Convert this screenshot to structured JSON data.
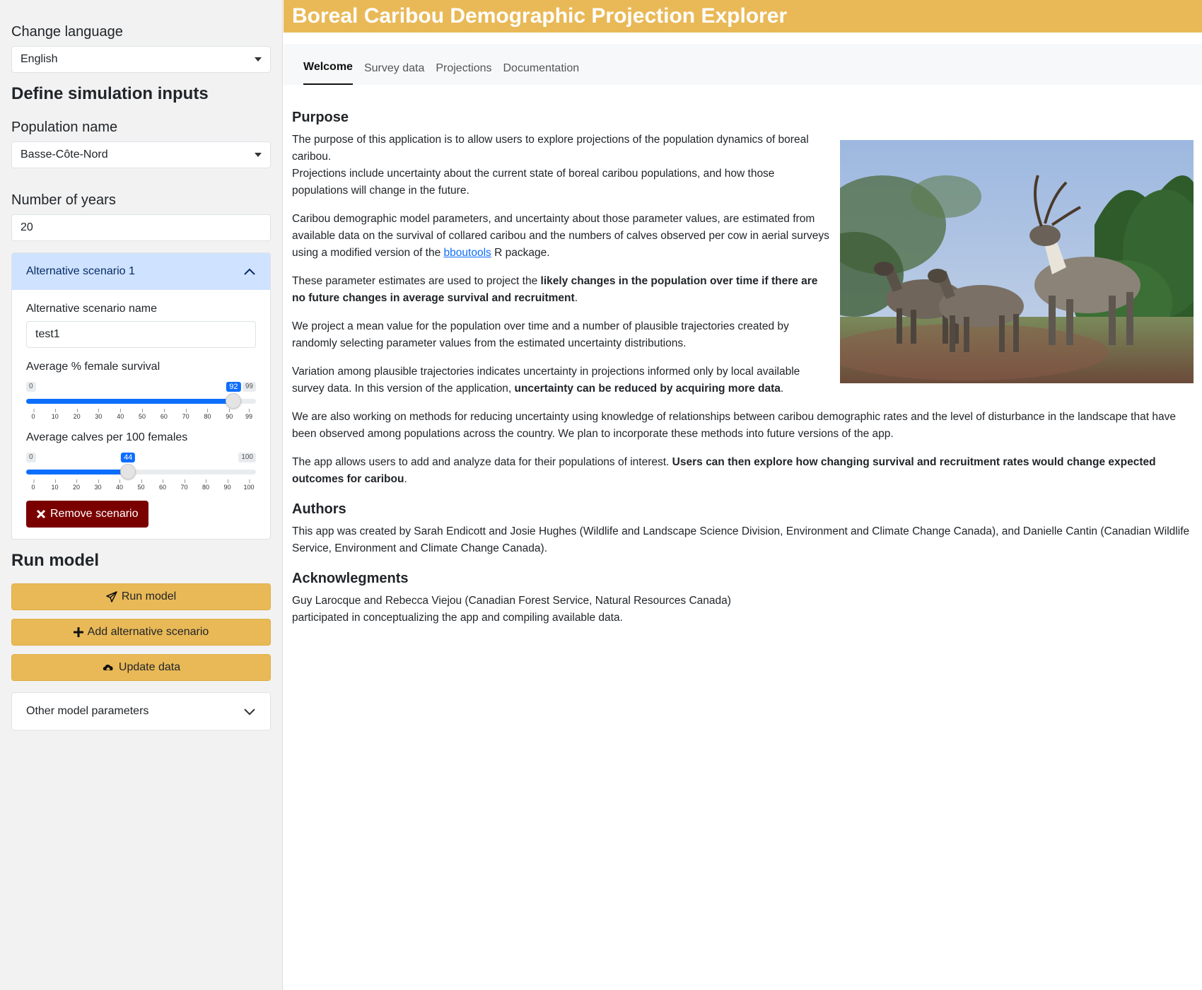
{
  "sidebar": {
    "language_label": "Change language",
    "language_value": "English",
    "inputs_heading": "Define simulation inputs",
    "population_label": "Population name",
    "population_value": "Basse-Côte-Nord",
    "years_label": "Number of years",
    "years_value": "20",
    "scenario_panel": {
      "title": "Alternative scenario 1",
      "name_label": "Alternative scenario name",
      "name_value": "test1",
      "survival": {
        "label": "Average % female survival",
        "min": 0,
        "max": 99,
        "value": 92,
        "ticks": [
          "0",
          "10",
          "20",
          "30",
          "40",
          "50",
          "60",
          "70",
          "80",
          "90",
          "99"
        ]
      },
      "calves": {
        "label": "Average calves per 100 females",
        "min": 0,
        "max": 100,
        "value": 44,
        "ticks": [
          "0",
          "10",
          "20",
          "30",
          "40",
          "50",
          "60",
          "70",
          "80",
          "90",
          "100"
        ]
      },
      "remove_label": "Remove scenario"
    },
    "run_heading": "Run model",
    "run_button": "Run model",
    "add_button": "Add alternative scenario",
    "update_button": "Update data",
    "other_params": "Other model parameters"
  },
  "header": {
    "title": "Boreal Caribou Demographic Projection Explorer"
  },
  "tabs": [
    "Welcome",
    "Survey data",
    "Projections",
    "Documentation"
  ],
  "content": {
    "purpose_heading": "Purpose",
    "p1a": "The purpose of this application is to allow users to explore projections of the population dynamics of boreal caribou.",
    "p1b": "Projections include uncertainty about the current state of boreal caribou populations, and how those populations will change in the future.",
    "p2_pre": "Caribou demographic model parameters, and uncertainty about those parameter values, are estimated from available data on the survival of collared caribou and the numbers of calves observed per cow in aerial surveys using a modified version of the ",
    "p2_link": "bboutools",
    "p2_post": " R package.",
    "p3_pre": "These parameter estimates are used to project the ",
    "p3_bold": "likely changes in the population over time if there are no future changes in average survival and recruitment",
    "p3_post": ".",
    "p4": "We project a mean value for the population over time and a number of plausible trajectories created by randomly selecting parameter values from the estimated uncertainty distributions.",
    "p5_pre": "Variation among plausible trajectories indicates uncertainty in projections informed only by local available survey data. In this version of the application, ",
    "p5_bold": "uncertainty can be reduced by acquiring more data",
    "p5_post": ".",
    "p6": "We are also working on methods for reducing uncertainty using knowledge of relationships between caribou demographic rates and the level of disturbance in the landscape that have been observed among populations across the country. We plan to incorporate these methods into future versions of the app.",
    "p7_pre": "The app allows users to add and analyze data for their populations of interest. ",
    "p7_bold": "Users can then explore how changing survival and recruitment rates would change expected outcomes for caribou",
    "p7_post": ".",
    "authors_heading": "Authors",
    "authors_text": "This app was created by Sarah Endicott and Josie Hughes (Wildlife and Landscape Science Division, Environment and Climate Change Canada), and Danielle Cantin (Canadian Wildlife Service, Environment and Climate Change Canada).",
    "ack_heading": "Acknowlegments",
    "ack_line1": "Guy Larocque and Rebecca Viejou (Canadian Forest Service, Natural Resources Canada)",
    "ack_line2": "participated in conceptualizing the app and compiling available data."
  },
  "colors": {
    "accent": "#e9b957",
    "slider": "#0d6efd",
    "danger": "#7a0000",
    "accordion_active": "#cfe2ff"
  }
}
